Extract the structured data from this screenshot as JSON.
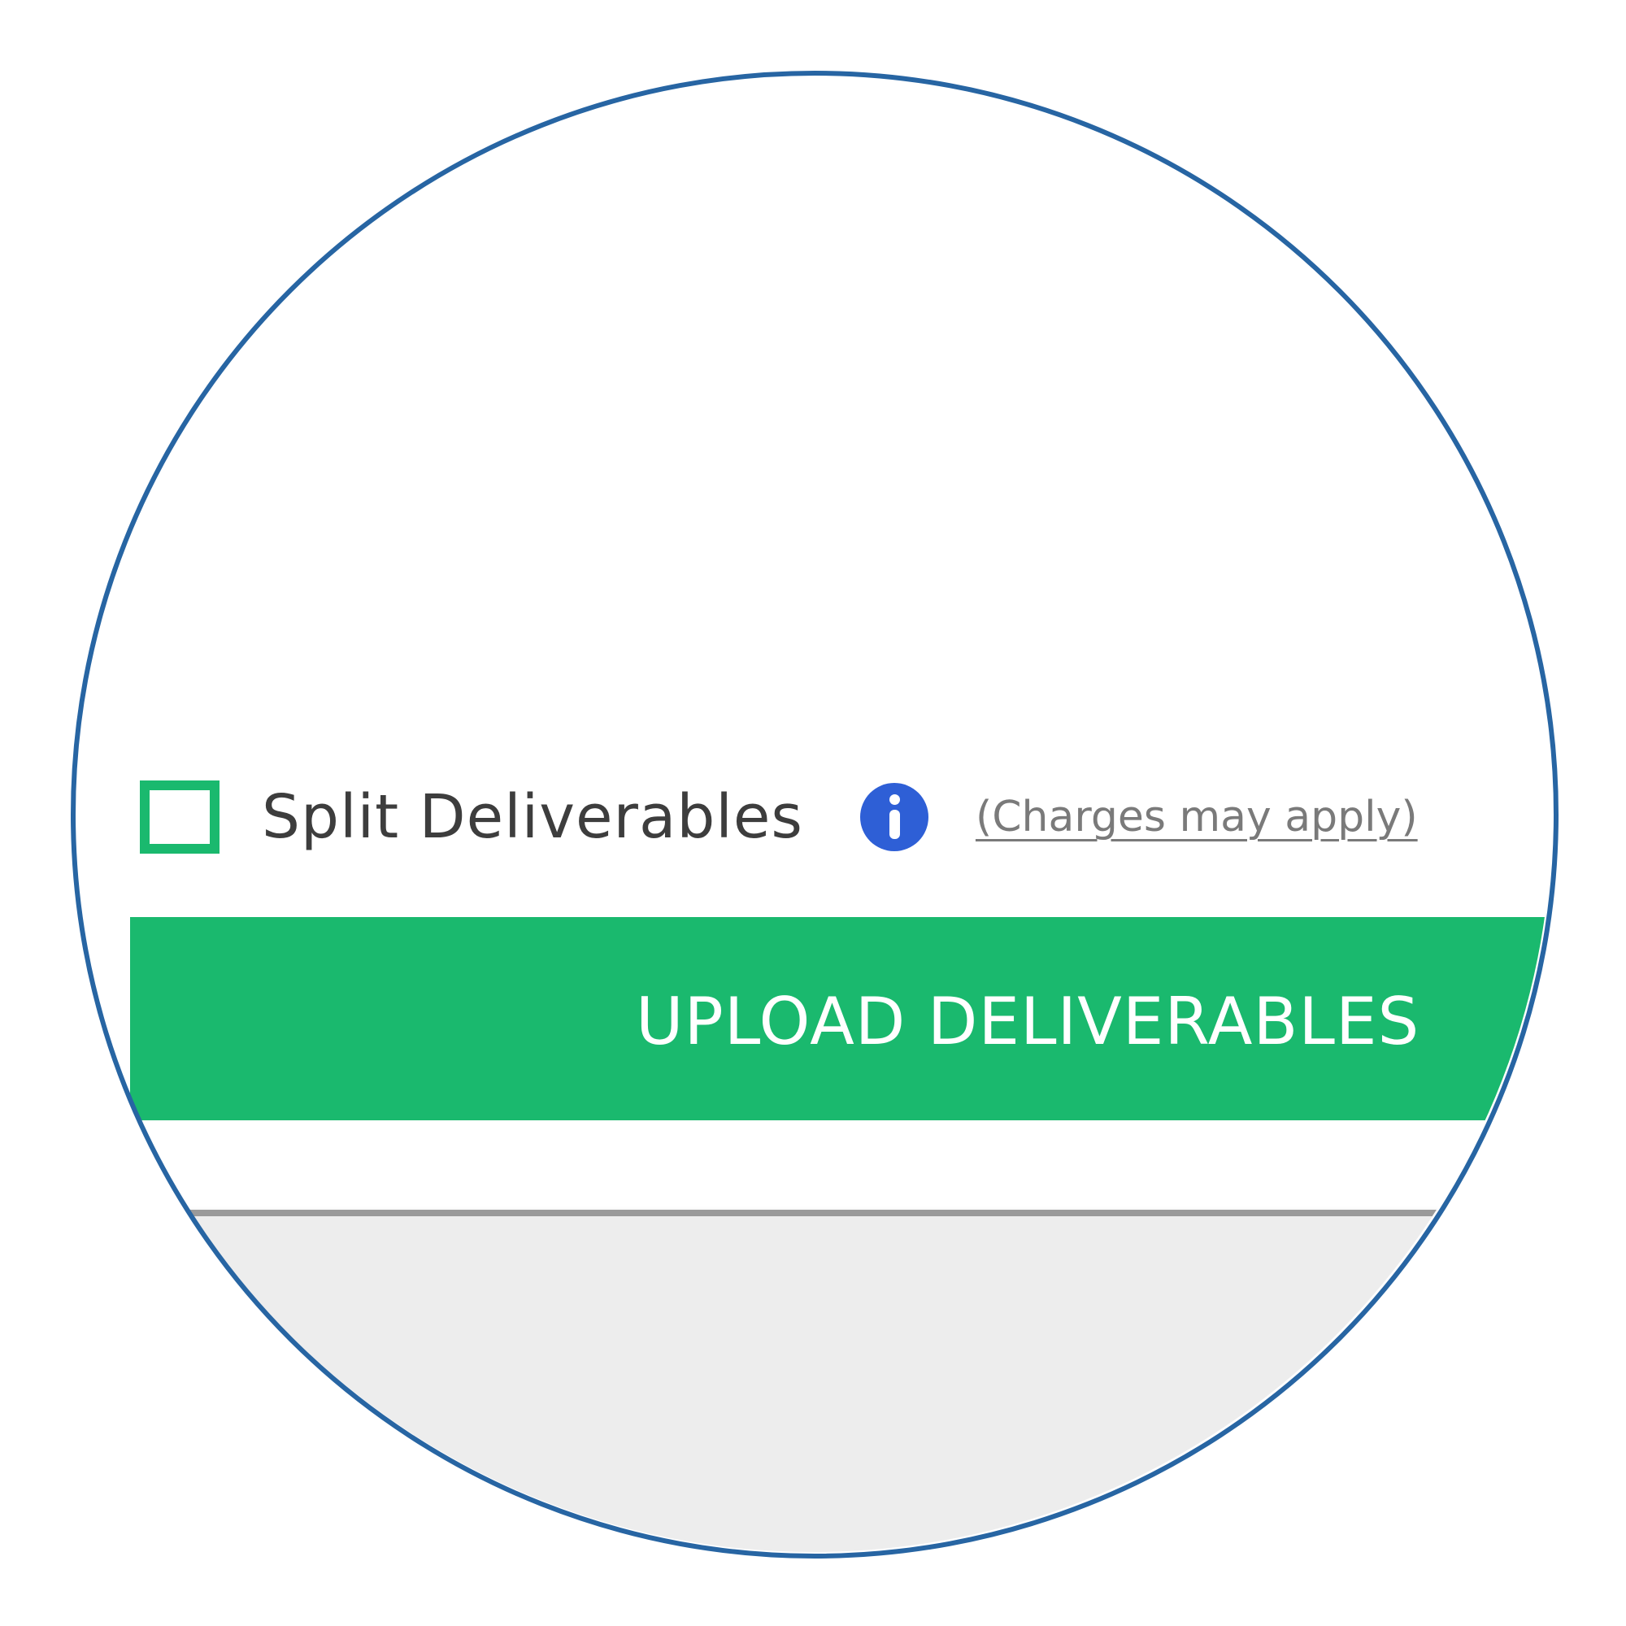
{
  "split_option": {
    "label": "Split Deliverables",
    "checked": false,
    "info_icon": "info-icon",
    "charges_note": "(Charges may apply)"
  },
  "upload_button": {
    "label": "UPLOAD DELIVERABLES"
  },
  "colors": {
    "accent_green": "#1ab96e",
    "info_blue": "#2e5fd6",
    "lens_border": "#2765a3",
    "footer_gray": "#ededed"
  }
}
